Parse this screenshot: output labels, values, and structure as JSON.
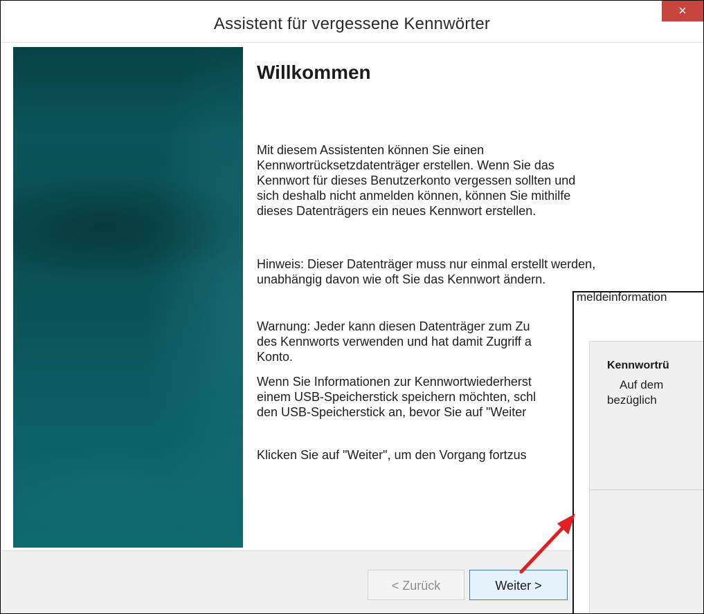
{
  "window": {
    "title": "Assistent für vergessene Kennwörter",
    "close_label": "×"
  },
  "main": {
    "heading": "Willkommen",
    "paragraphs": [
      "Mit diesem Assistenten können Sie einen\nKennwortrücksetzdatenträger erstellen. Wenn Sie das\nKennwort für dieses Benutzerkonto vergessen sollten und\nsich deshalb nicht anmelden können, können Sie mithilfe\ndieses Datenträgers ein neues Kennwort erstellen.",
      "Hinweis: Dieser Datenträger muss nur einmal erstellt werden,\nunabhängig davon wie oft Sie das Kennwort ändern.",
      "Warnung: Jeder kann diesen Datenträger zum Zu\ndes Kennworts verwenden und hat damit Zugriff a\nKonto.",
      "Wenn Sie Informationen zur Kennwortwiederherst\neinem USB-Speicherstick speichern möchten, schl\nden USB-Speicherstick an, bevor Sie auf \"Weiter",
      "Klicken Sie auf \"Weiter\", um den Vorgang fortzus"
    ]
  },
  "footer": {
    "back_label": "< Zurück",
    "next_label": "Weiter >"
  },
  "overlay_window": {
    "top_text": "meldeinformation",
    "title": "Kennwortrü",
    "line1": "Auf dem",
    "line2": "bezüglich"
  },
  "colors": {
    "close_button": "#c7453e",
    "side_panel": "#0a555a",
    "arrow": "#e02020"
  }
}
